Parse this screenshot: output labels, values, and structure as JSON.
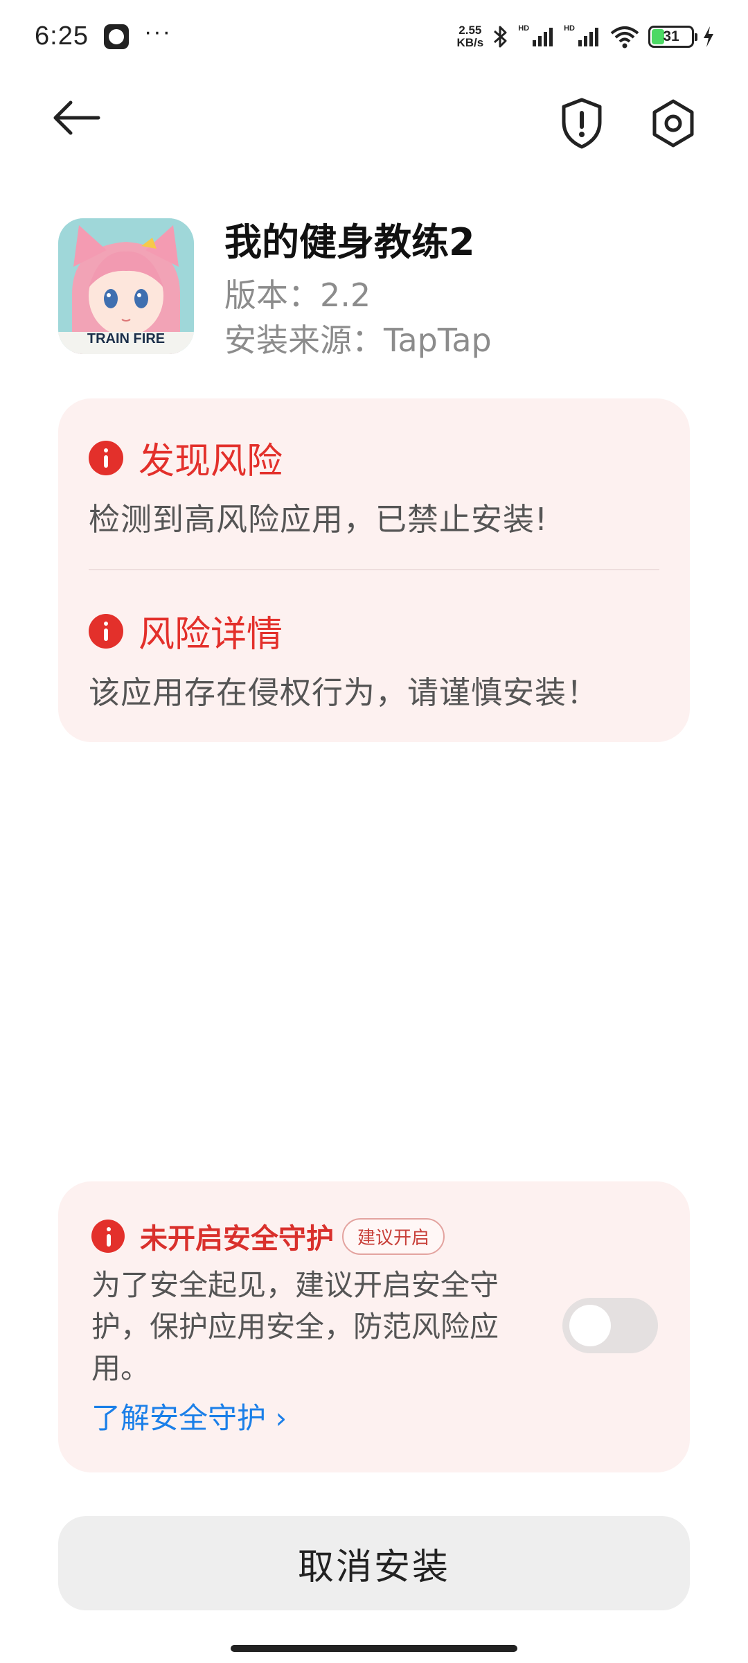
{
  "status_bar": {
    "time": "6:25",
    "more": "···",
    "network_speed_value": "2.55",
    "network_speed_unit": "KB/s",
    "hd_label_1": "HD",
    "hd_label_2": "HD",
    "battery": "31"
  },
  "top_bar": {
    "back_icon": "arrow-left-icon",
    "shield_icon": "shield-exclamation-icon",
    "settings_icon": "settings-icon"
  },
  "app": {
    "name": "我的健身教练2",
    "version": "版本：2.2",
    "source": "安装来源：TapTap",
    "icon_caption": "TRAIN FIRE"
  },
  "risk": {
    "found_title": "发现风险",
    "found_desc": "检测到高风险应用，已禁止安装!",
    "detail_title": "风险详情",
    "detail_desc": "该应用存在侵权行为，请谨慎安装！"
  },
  "protection": {
    "title": "未开启安全守护",
    "badge": "建议开启",
    "description": "为了安全起见，建议开启安全守护，保护应用安全，防范风险应用。",
    "link": "了解安全守护",
    "toggle_on": false
  },
  "cancel_button": "取消安装",
  "colors": {
    "risk_red": "#e3302b",
    "card_bg": "#fdf1f0",
    "link_blue": "#1b7fe8"
  }
}
